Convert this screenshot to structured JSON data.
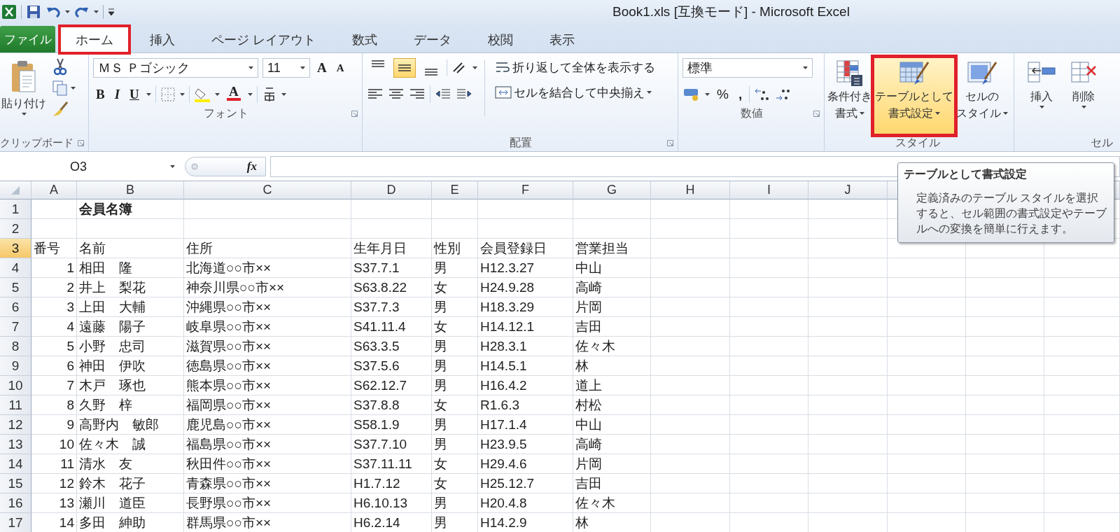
{
  "window": {
    "title": "Book1.xls  [互換モード] - Microsoft Excel"
  },
  "file_tab": "ファイル",
  "tabs": [
    {
      "label": "ホーム",
      "selected": true,
      "marked": true
    },
    {
      "label": "挿入",
      "selected": false,
      "marked": false
    },
    {
      "label": "ページ レイアウト",
      "selected": false,
      "marked": false
    },
    {
      "label": "数式",
      "selected": false,
      "marked": false
    },
    {
      "label": "データ",
      "selected": false,
      "marked": false
    },
    {
      "label": "校閲",
      "selected": false,
      "marked": false
    },
    {
      "label": "表示",
      "selected": false,
      "marked": false
    }
  ],
  "ribbon": {
    "clipboard": {
      "paste": "貼り付け",
      "label": "クリップボード"
    },
    "font": {
      "name": "ＭＳ Ｐゴシック",
      "size": "11",
      "grow": "A",
      "shrink": "A",
      "bold": "B",
      "italic": "I",
      "underline": "U",
      "font_color": "A",
      "label": "フォント"
    },
    "alignment": {
      "vertical": [
        {
          "selected": false
        },
        {
          "selected": true
        },
        {
          "selected": false
        }
      ],
      "wrap": "折り返して全体を表示する",
      "merge": "セルを結合して中央揃え",
      "label": "配置"
    },
    "number": {
      "format": "標準",
      "percent": "%",
      "comma": ",",
      "label": "数値"
    },
    "styles": {
      "buttons": [
        {
          "kind": "conditional",
          "lines": [
            "条件付き",
            "書式"
          ],
          "hovered": false,
          "marked": false
        },
        {
          "kind": "table",
          "lines": [
            "テーブルとして",
            "書式設定"
          ],
          "hovered": true,
          "marked": true
        },
        {
          "kind": "cell_style",
          "lines": [
            "セルの",
            "スタイル"
          ],
          "hovered": false,
          "marked": false
        }
      ],
      "label": "スタイル"
    },
    "cells": {
      "buttons": [
        {
          "kind": "insert",
          "label": "挿入"
        },
        {
          "kind": "delete",
          "label": "削除"
        }
      ],
      "label": "セル"
    }
  },
  "formula_bar": {
    "name_box": "O3",
    "fx": "fx"
  },
  "grid": {
    "columns": [
      "A",
      "B",
      "C",
      "D",
      "E",
      "F",
      "G",
      "H",
      "I",
      "J"
    ],
    "rows": [
      {
        "header": "1",
        "selected": false,
        "kind": "title",
        "cells": [
          null,
          "会員名簿"
        ]
      },
      {
        "header": "2",
        "selected": false,
        "kind": "blank"
      },
      {
        "header": "3",
        "selected": true,
        "kind": "header",
        "cells": [
          "番号",
          "名前",
          "住所",
          "生年月日",
          "性別",
          "会員登録日",
          "営業担当"
        ]
      },
      {
        "header": "4",
        "selected": false,
        "kind": "data",
        "cells": [
          "1",
          "相田　隆",
          "北海道○○市××",
          "S37.7.1",
          "男",
          "H12.3.27",
          "中山"
        ]
      },
      {
        "header": "5",
        "selected": false,
        "kind": "data",
        "cells": [
          "2",
          "井上　梨花",
          "神奈川県○○市××",
          "S63.8.22",
          "女",
          "H24.9.28",
          "高崎"
        ]
      },
      {
        "header": "6",
        "selected": false,
        "kind": "data",
        "cells": [
          "3",
          "上田　大輔",
          "沖縄県○○市××",
          "S37.7.3",
          "男",
          "H18.3.29",
          "片岡"
        ]
      },
      {
        "header": "7",
        "selected": false,
        "kind": "data",
        "cells": [
          "4",
          "遠藤　陽子",
          "岐阜県○○市××",
          "S41.11.4",
          "女",
          "H14.12.1",
          "吉田"
        ]
      },
      {
        "header": "8",
        "selected": false,
        "kind": "data",
        "cells": [
          "5",
          "小野　忠司",
          "滋賀県○○市××",
          "S63.3.5",
          "男",
          "H28.3.1",
          "佐々木"
        ]
      },
      {
        "header": "9",
        "selected": false,
        "kind": "data",
        "cells": [
          "6",
          "神田　伊吹",
          "徳島県○○市××",
          "S37.5.6",
          "男",
          "H14.5.1",
          "林"
        ]
      },
      {
        "header": "10",
        "selected": false,
        "kind": "data",
        "cells": [
          "7",
          "木戸　琢也",
          "熊本県○○市××",
          "S62.12.7",
          "男",
          "H16.4.2",
          "道上"
        ]
      },
      {
        "header": "11",
        "selected": false,
        "kind": "data",
        "cells": [
          "8",
          "久野　梓",
          "福岡県○○市××",
          "S37.8.8",
          "女",
          "R1.6.3",
          "村松"
        ]
      },
      {
        "header": "12",
        "selected": false,
        "kind": "data",
        "cells": [
          "9",
          "高野内　敏郎",
          "鹿児島○○市××",
          "S58.1.9",
          "男",
          "H17.1.4",
          "中山"
        ]
      },
      {
        "header": "13",
        "selected": false,
        "kind": "data",
        "cells": [
          "10",
          "佐々木　誠",
          "福島県○○市××",
          "S37.7.10",
          "男",
          "H23.9.5",
          "高崎"
        ]
      },
      {
        "header": "14",
        "selected": false,
        "kind": "data",
        "cells": [
          "11",
          "清水　友",
          "秋田件○○市××",
          "S37.11.11",
          "女",
          "H29.4.6",
          "片岡"
        ]
      },
      {
        "header": "15",
        "selected": false,
        "kind": "data",
        "cells": [
          "12",
          "鈴木　花子",
          "青森県○○市××",
          "H1.7.12",
          "女",
          "H25.12.7",
          "吉田"
        ]
      },
      {
        "header": "16",
        "selected": false,
        "kind": "data",
        "cells": [
          "13",
          "瀬川　道臣",
          "長野県○○市××",
          "H6.10.13",
          "男",
          "H20.4.8",
          "佐々木"
        ]
      },
      {
        "header": "17",
        "selected": false,
        "kind": "data",
        "cells": [
          "14",
          "多田　紳助",
          "群馬県○○市××",
          "H6.2.14",
          "男",
          "H14.2.9",
          "林"
        ]
      }
    ]
  },
  "tooltip": {
    "title": "テーブルとして書式設定",
    "body": "定義済みのテーブル スタイルを選択すると、セル範囲の書式設定やテーブルへの変換を簡単に行えます。"
  }
}
